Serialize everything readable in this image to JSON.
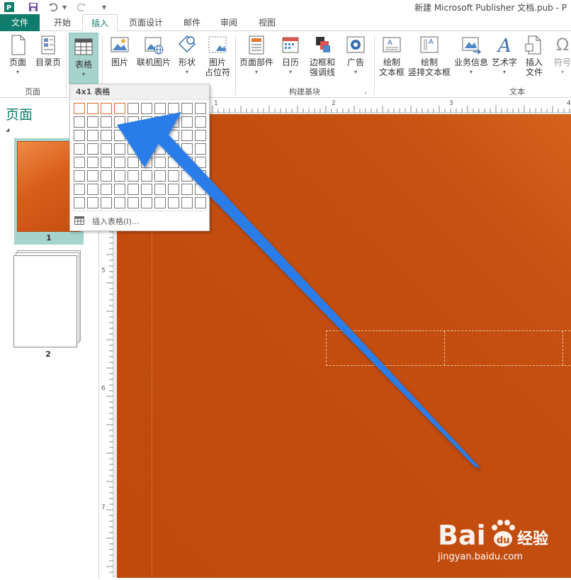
{
  "window": {
    "title": "新建 Microsoft Publisher 文档.pub - P"
  },
  "tabs": [
    {
      "label": "文件"
    },
    {
      "label": "开始"
    },
    {
      "label": "插入"
    },
    {
      "label": "页面设计"
    },
    {
      "label": "邮件"
    },
    {
      "label": "审阅"
    },
    {
      "label": "视图"
    }
  ],
  "ribbon": {
    "page_btn": "页面",
    "toc_btn": "目录页",
    "table_btn": "表格",
    "picture_btn": "图片",
    "online_picture_btn": "联机图片",
    "shapes_btn": "形状",
    "placeholder_btn_l1": "图片",
    "placeholder_btn_l2": "占位符",
    "page_parts_btn": "页面部件",
    "calendar_btn": "日历",
    "borders_btn_l1": "边框和",
    "borders_btn_l2": "强调线",
    "ad_btn": "广告",
    "draw_textbox_l1": "绘制",
    "draw_textbox_l2": "文本框",
    "draw_vtextbox_l1": "绘制",
    "draw_vtextbox_l2": "竖排文本框",
    "business_info_btn": "业务信息",
    "wordart_btn": "艺术字",
    "insert_file_l1": "插入",
    "insert_file_l2": "文件",
    "symbol_btn": "符号",
    "groups": {
      "pages": "页面",
      "building_blocks": "构建基块",
      "text": "文本"
    }
  },
  "nav": {
    "title": "页面",
    "pages": [
      {
        "number": "1"
      },
      {
        "number": "2"
      }
    ]
  },
  "table_dropdown": {
    "header": "4x1 表格",
    "columns": 10,
    "rows": 8,
    "selected_cols": 4,
    "selected_rows": 1,
    "insert_table_label": "插入表格(I)..."
  },
  "rulers": {
    "h_labels": [
      "1",
      "2",
      "3",
      "4"
    ],
    "v_labels": [
      "5",
      "6",
      "7"
    ]
  },
  "colors": {
    "accent": "#107c6c",
    "page_fill": "#c24d0f",
    "arrow": "#2b7de9",
    "grid_highlight": "#e06a2a"
  },
  "watermark": {
    "brand": "Baidu经验",
    "url": "jingyan.baidu.com"
  }
}
